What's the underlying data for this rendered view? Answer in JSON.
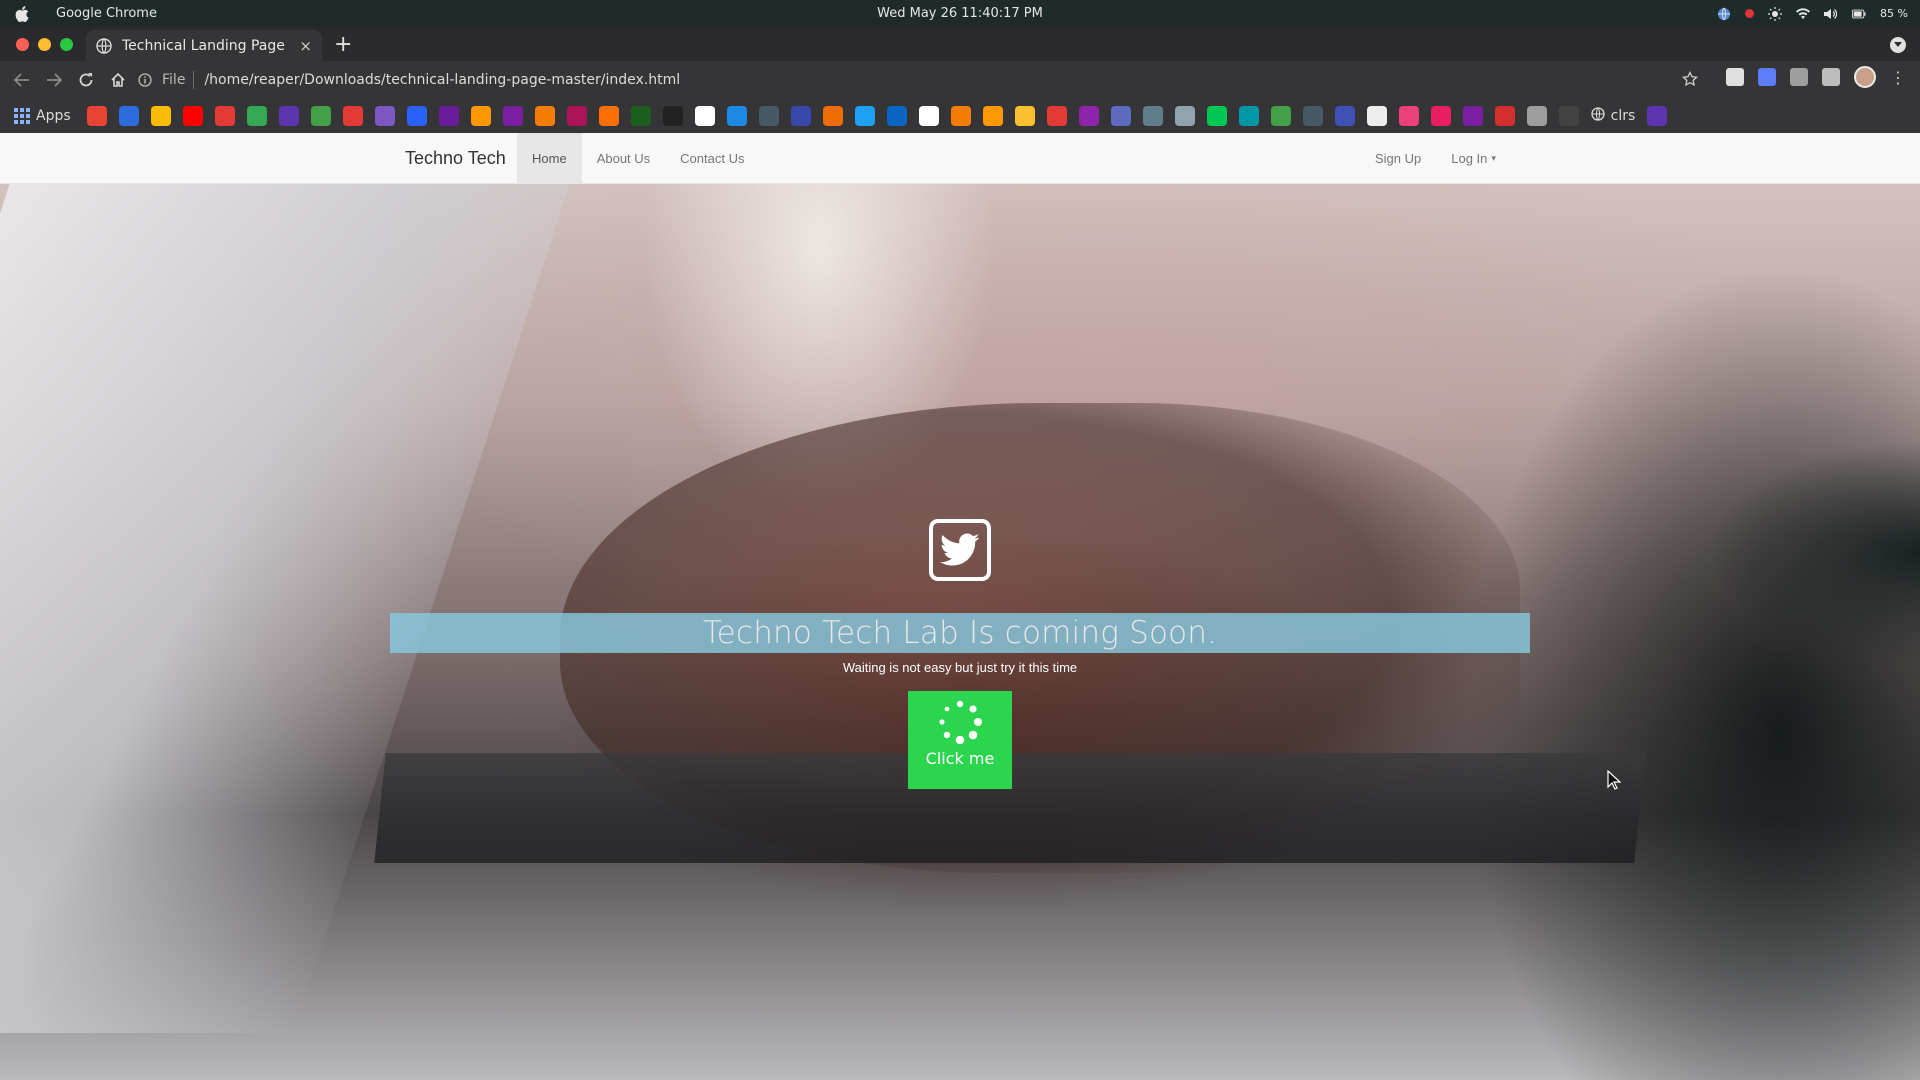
{
  "os": {
    "app_name": "Google Chrome",
    "clock": "Wed May 26  11:40:17 PM",
    "battery": "85 %"
  },
  "browser": {
    "tab_title": "Technical Landing Page",
    "tab_close": "×",
    "new_tab": "+",
    "url_scheme": "File",
    "url": "/home/reaper/Downloads/technical-landing-page-master/index.html"
  },
  "bookmarks": {
    "apps_label": "Apps",
    "last_label": "clrs",
    "colors": [
      "#ea4335",
      "#2d6cdf",
      "#fbbc05",
      "#ff0000",
      "#e53935",
      "#34a853",
      "#5e35b1",
      "#43a047",
      "#e53935",
      "#7e57c2",
      "#2962ff",
      "#6a1b9a",
      "#ff9800",
      "#7b1fa2",
      "#f57c00",
      "#ad1457",
      "#ff6f00",
      "#1b5e20",
      "#212121",
      "#ffffff",
      "#1e88e5",
      "#455a64",
      "#3949ab",
      "#ef6c00",
      "#1da1f2",
      "#0a66c2",
      "#ffffff",
      "#f57c00",
      "#ff9900",
      "#fbc02d",
      "#e53935",
      "#8e24aa",
      "#5c6bc0",
      "#607d8b",
      "#90a4ae",
      "#00c853",
      "#0097a7",
      "#43a047",
      "#455a64",
      "#3f51b5",
      "#eeeeee",
      "#ec407a",
      "#e91e63",
      "#7b1fa2",
      "#d32f2f",
      "#9e9e9e",
      "#424242"
    ]
  },
  "navbar": {
    "brand": "Techno Tech",
    "links": [
      "Home",
      "About Us",
      "Contact Us"
    ],
    "right": [
      "Sign Up",
      "Log In"
    ],
    "caret": "▾"
  },
  "hero": {
    "headline": "Techno Tech Lab Is coming Soon.",
    "subline": "Waiting is not easy but just try it this time",
    "cta_label": "Click me",
    "band_color": "#87c8de",
    "cta_color": "#2bd54d"
  }
}
